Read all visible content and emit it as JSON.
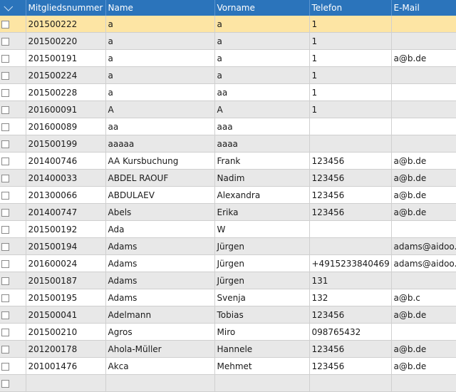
{
  "columns": [
    "Mitgliedsnummer",
    "Name",
    "Vorname",
    "Telefon",
    "E-Mail"
  ],
  "rows": [
    {
      "num": "201500222",
      "name": "a",
      "vorname": "a",
      "tel": "1",
      "mail": "",
      "selected": true
    },
    {
      "num": "201500220",
      "name": "a",
      "vorname": "a",
      "tel": "1",
      "mail": ""
    },
    {
      "num": "201500191",
      "name": "a",
      "vorname": "a",
      "tel": "1",
      "mail": "a@b.de"
    },
    {
      "num": "201500224",
      "name": "a",
      "vorname": "a",
      "tel": "1",
      "mail": ""
    },
    {
      "num": "201500228",
      "name": "a",
      "vorname": "aa",
      "tel": "1",
      "mail": ""
    },
    {
      "num": "201600091",
      "name": "A",
      "vorname": "A",
      "tel": "1",
      "mail": ""
    },
    {
      "num": "201600089",
      "name": "aa",
      "vorname": "aaa",
      "tel": "",
      "mail": ""
    },
    {
      "num": "201500199",
      "name": "aaaaa",
      "vorname": "aaaa",
      "tel": "",
      "mail": ""
    },
    {
      "num": "201400746",
      "name": "AA Kursbuchung",
      "vorname": "Frank",
      "tel": "123456",
      "mail": "a@b.de"
    },
    {
      "num": "201400033",
      "name": "ABDEL RAOUF",
      "vorname": "Nadim",
      "tel": "123456",
      "mail": "a@b.de"
    },
    {
      "num": "201300066",
      "name": "ABDULAEV",
      "vorname": "Alexandra",
      "tel": "123456",
      "mail": "a@b.de"
    },
    {
      "num": "201400747",
      "name": "Abels",
      "vorname": "Erika",
      "tel": "123456",
      "mail": "a@b.de"
    },
    {
      "num": "201500192",
      "name": "Ada",
      "vorname": "W",
      "tel": "",
      "mail": ""
    },
    {
      "num": "201500194",
      "name": "Adams",
      "vorname": "Jürgen",
      "tel": "",
      "mail": "adams@aidoo.de"
    },
    {
      "num": "201600024",
      "name": "Adams",
      "vorname": "Jürgen",
      "tel": "+4915233840469",
      "mail": "adams@aidoo.de"
    },
    {
      "num": "201500187",
      "name": "Adams",
      "vorname": "Jürgen",
      "tel": "131",
      "mail": ""
    },
    {
      "num": "201500195",
      "name": "Adams",
      "vorname": "Svenja",
      "tel": "132",
      "mail": "a@b.c"
    },
    {
      "num": "201500041",
      "name": "Adelmann",
      "vorname": "Tobias",
      "tel": "123456",
      "mail": "a@b.de"
    },
    {
      "num": "201500210",
      "name": "Agros",
      "vorname": "Miro",
      "tel": "098765432",
      "mail": ""
    },
    {
      "num": "201200178",
      "name": "Ahola-Müller",
      "vorname": "Hannele",
      "tel": "123456",
      "mail": "a@b.de"
    },
    {
      "num": "201001476",
      "name": "Akca",
      "vorname": "Mehmet",
      "tel": "123456",
      "mail": "a@b.de"
    },
    {
      "num": "",
      "name": "",
      "vorname": "",
      "tel": "",
      "mail": ""
    }
  ],
  "colors": {
    "header": "#2b74bb",
    "selected": "#fde5a4",
    "stripe": "#e8e8e8"
  }
}
